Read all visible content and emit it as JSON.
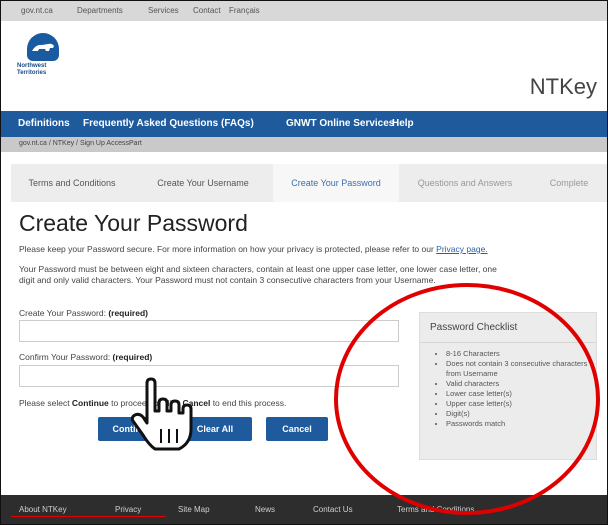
{
  "gov_bar": {
    "links": [
      "gov.nt.ca",
      "Departments",
      "Services",
      "Contact",
      "Français"
    ]
  },
  "header": {
    "logo_text": "Northwest Territories",
    "app_title": "NTKey"
  },
  "nav": {
    "items": [
      "Definitions",
      "Frequently Asked Questions (FAQs)",
      "GNWT Online Services",
      "Help"
    ]
  },
  "breadcrumb": {
    "text": "gov.nt.ca  /  NTKey  /  Sign Up AccessPart"
  },
  "steps": [
    "Terms and Conditions",
    "Create Your Username",
    "Create Your Password",
    "Questions and Answers",
    "Complete"
  ],
  "main": {
    "title": "Create Your Password",
    "intro_pre": "Please keep your Password secure. For more information on how your privacy is protected, please refer to our ",
    "intro_link": "Privacy page.",
    "rules_line1": "Your Password must be between eight and sixteen characters, contain at least one upper case letter, one lower case letter, one",
    "rules_line2": "digit and only valid characters. Your Password must not contain 3 consecutive characters from your Username.",
    "password_label": "Create Your Password: ",
    "confirm_label": "Confirm Your Password: ",
    "required": "(required)",
    "select_pre": "Please select ",
    "continue_word": "Continue",
    "select_mid": " to proceed or click ",
    "cancel_word": "Cancel",
    "select_post": " to end this process.",
    "buttons": {
      "continue": "Continue",
      "clear": "Clear All",
      "cancel": "Cancel"
    }
  },
  "checklist": {
    "title": "Password Checklist",
    "items": [
      "8-16 Characters",
      "Does not contain 3 consecutive characters from Username",
      "Valid characters",
      "Lower case letter(s)",
      "Upper case letter(s)",
      "Digit(s)",
      "Passwords match"
    ]
  },
  "footer": {
    "links": [
      "About NTKey",
      "Privacy",
      "Site Map",
      "News",
      "Contact Us",
      "Terms and Conditions"
    ]
  },
  "colors": {
    "nav_blue": "#1f5a9d",
    "annotation_red": "#e00000",
    "footer": "#2d2d2d"
  }
}
